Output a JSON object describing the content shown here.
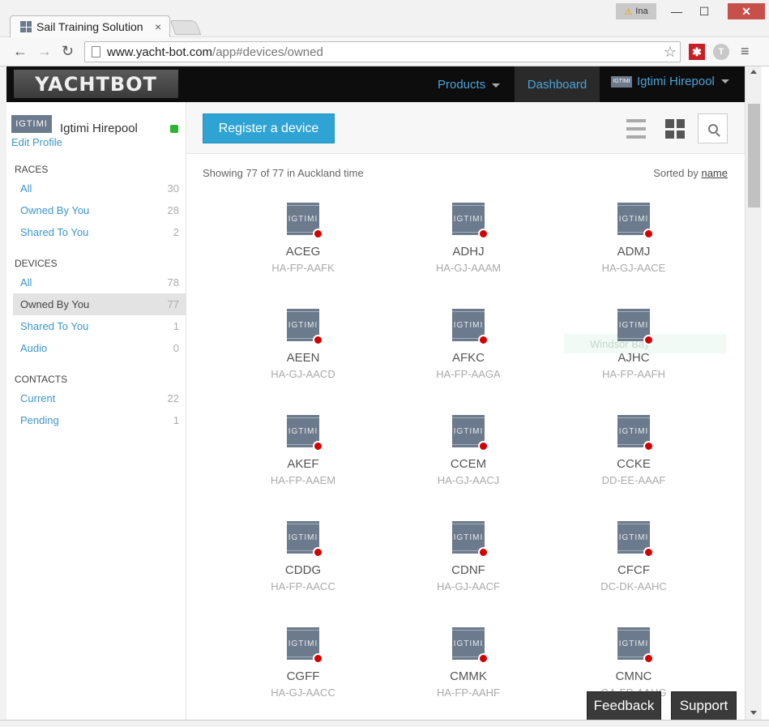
{
  "browser": {
    "tab_title": "Sail Training Solution",
    "tab_close": "×",
    "user_badge": "Ina",
    "warn_symbol": "⚠",
    "win_min": "—",
    "win_max": "☐",
    "win_close": "✕",
    "url_host": "www.yacht-bot.com",
    "url_path": "/app#devices/owned",
    "back": "←",
    "forward": "→",
    "reload": "↻",
    "star": "☆",
    "menu": "≡",
    "ext1_symbol": "✱",
    "ext2_symbol": "T"
  },
  "header": {
    "logo_text": "YACHTBOT",
    "products_label": "Products",
    "dashboard_label": "Dashboard",
    "user_label": "Igtimi Hirepool",
    "user_logo": "IGTIMI"
  },
  "sidebar": {
    "profile_logo": "IGTIMI",
    "profile_name": "Igtimi Hirepool",
    "edit_profile": "Edit Profile",
    "races": {
      "heading": "RACES",
      "items": [
        {
          "label": "All",
          "count": "30"
        },
        {
          "label": "Owned By You",
          "count": "28"
        },
        {
          "label": "Shared To You",
          "count": "2"
        }
      ]
    },
    "devices": {
      "heading": "DEVICES",
      "items": [
        {
          "label": "All",
          "count": "78"
        },
        {
          "label": "Owned By You",
          "count": "77"
        },
        {
          "label": "Shared To You",
          "count": "1"
        },
        {
          "label": "Audio",
          "count": "0"
        }
      ]
    },
    "contacts": {
      "heading": "CONTACTS",
      "items": [
        {
          "label": "Current",
          "count": "22"
        },
        {
          "label": "Pending",
          "count": "1"
        }
      ]
    }
  },
  "main": {
    "register_label": "Register a device",
    "showing_text": "Showing 77 of 77 in Auckland time",
    "sorted_prefix": "Sorted by ",
    "sorted_field": "name",
    "device_logo": "IGTIMI",
    "devices": [
      {
        "name": "ACEG",
        "id": "HA-FP-AAFK"
      },
      {
        "name": "ADHJ",
        "id": "HA-GJ-AAAM"
      },
      {
        "name": "ADMJ",
        "id": "HA-GJ-AACE"
      },
      {
        "name": "AEEN",
        "id": "HA-GJ-AACD"
      },
      {
        "name": "AFKC",
        "id": "HA-FP-AAGA"
      },
      {
        "name": "AJHC",
        "id": "HA-FP-AAFH"
      },
      {
        "name": "AKEF",
        "id": "HA-FP-AAEM"
      },
      {
        "name": "CCEM",
        "id": "HA-GJ-AACJ"
      },
      {
        "name": "CCKE",
        "id": "DD-EE-AAAF"
      },
      {
        "name": "CDDG",
        "id": "HA-FP-AACC"
      },
      {
        "name": "CDNF",
        "id": "HA-GJ-AACF"
      },
      {
        "name": "CFCF",
        "id": "DC-DK-AAHC"
      },
      {
        "name": "CGFF",
        "id": "HA-GJ-AACC"
      },
      {
        "name": "CMMK",
        "id": "HA-FP-AAHF"
      },
      {
        "name": "CMNC",
        "id": "GA-FP-AAHG"
      }
    ],
    "status_color": "#d40000",
    "watermark": "Windsor Bay"
  },
  "footer": {
    "feedback_label": "Feedback",
    "support_label": "Support"
  },
  "colors": {
    "accent": "#2fa4d4",
    "link": "#3a96cc",
    "header_bg": "#0d0d0d"
  }
}
